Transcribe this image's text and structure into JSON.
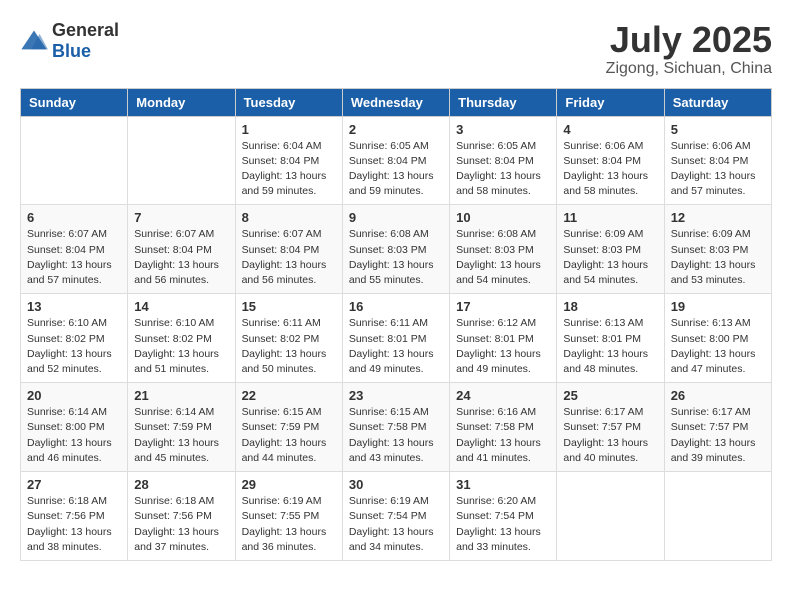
{
  "header": {
    "logo_general": "General",
    "logo_blue": "Blue",
    "title": "July 2025",
    "subtitle": "Zigong, Sichuan, China"
  },
  "calendar": {
    "days_of_week": [
      "Sunday",
      "Monday",
      "Tuesday",
      "Wednesday",
      "Thursday",
      "Friday",
      "Saturday"
    ],
    "weeks": [
      [
        {
          "day": "",
          "info": ""
        },
        {
          "day": "",
          "info": ""
        },
        {
          "day": "1",
          "info": "Sunrise: 6:04 AM\nSunset: 8:04 PM\nDaylight: 13 hours and 59 minutes."
        },
        {
          "day": "2",
          "info": "Sunrise: 6:05 AM\nSunset: 8:04 PM\nDaylight: 13 hours and 59 minutes."
        },
        {
          "day": "3",
          "info": "Sunrise: 6:05 AM\nSunset: 8:04 PM\nDaylight: 13 hours and 58 minutes."
        },
        {
          "day": "4",
          "info": "Sunrise: 6:06 AM\nSunset: 8:04 PM\nDaylight: 13 hours and 58 minutes."
        },
        {
          "day": "5",
          "info": "Sunrise: 6:06 AM\nSunset: 8:04 PM\nDaylight: 13 hours and 57 minutes."
        }
      ],
      [
        {
          "day": "6",
          "info": "Sunrise: 6:07 AM\nSunset: 8:04 PM\nDaylight: 13 hours and 57 minutes."
        },
        {
          "day": "7",
          "info": "Sunrise: 6:07 AM\nSunset: 8:04 PM\nDaylight: 13 hours and 56 minutes."
        },
        {
          "day": "8",
          "info": "Sunrise: 6:07 AM\nSunset: 8:04 PM\nDaylight: 13 hours and 56 minutes."
        },
        {
          "day": "9",
          "info": "Sunrise: 6:08 AM\nSunset: 8:03 PM\nDaylight: 13 hours and 55 minutes."
        },
        {
          "day": "10",
          "info": "Sunrise: 6:08 AM\nSunset: 8:03 PM\nDaylight: 13 hours and 54 minutes."
        },
        {
          "day": "11",
          "info": "Sunrise: 6:09 AM\nSunset: 8:03 PM\nDaylight: 13 hours and 54 minutes."
        },
        {
          "day": "12",
          "info": "Sunrise: 6:09 AM\nSunset: 8:03 PM\nDaylight: 13 hours and 53 minutes."
        }
      ],
      [
        {
          "day": "13",
          "info": "Sunrise: 6:10 AM\nSunset: 8:02 PM\nDaylight: 13 hours and 52 minutes."
        },
        {
          "day": "14",
          "info": "Sunrise: 6:10 AM\nSunset: 8:02 PM\nDaylight: 13 hours and 51 minutes."
        },
        {
          "day": "15",
          "info": "Sunrise: 6:11 AM\nSunset: 8:02 PM\nDaylight: 13 hours and 50 minutes."
        },
        {
          "day": "16",
          "info": "Sunrise: 6:11 AM\nSunset: 8:01 PM\nDaylight: 13 hours and 49 minutes."
        },
        {
          "day": "17",
          "info": "Sunrise: 6:12 AM\nSunset: 8:01 PM\nDaylight: 13 hours and 49 minutes."
        },
        {
          "day": "18",
          "info": "Sunrise: 6:13 AM\nSunset: 8:01 PM\nDaylight: 13 hours and 48 minutes."
        },
        {
          "day": "19",
          "info": "Sunrise: 6:13 AM\nSunset: 8:00 PM\nDaylight: 13 hours and 47 minutes."
        }
      ],
      [
        {
          "day": "20",
          "info": "Sunrise: 6:14 AM\nSunset: 8:00 PM\nDaylight: 13 hours and 46 minutes."
        },
        {
          "day": "21",
          "info": "Sunrise: 6:14 AM\nSunset: 7:59 PM\nDaylight: 13 hours and 45 minutes."
        },
        {
          "day": "22",
          "info": "Sunrise: 6:15 AM\nSunset: 7:59 PM\nDaylight: 13 hours and 44 minutes."
        },
        {
          "day": "23",
          "info": "Sunrise: 6:15 AM\nSunset: 7:58 PM\nDaylight: 13 hours and 43 minutes."
        },
        {
          "day": "24",
          "info": "Sunrise: 6:16 AM\nSunset: 7:58 PM\nDaylight: 13 hours and 41 minutes."
        },
        {
          "day": "25",
          "info": "Sunrise: 6:17 AM\nSunset: 7:57 PM\nDaylight: 13 hours and 40 minutes."
        },
        {
          "day": "26",
          "info": "Sunrise: 6:17 AM\nSunset: 7:57 PM\nDaylight: 13 hours and 39 minutes."
        }
      ],
      [
        {
          "day": "27",
          "info": "Sunrise: 6:18 AM\nSunset: 7:56 PM\nDaylight: 13 hours and 38 minutes."
        },
        {
          "day": "28",
          "info": "Sunrise: 6:18 AM\nSunset: 7:56 PM\nDaylight: 13 hours and 37 minutes."
        },
        {
          "day": "29",
          "info": "Sunrise: 6:19 AM\nSunset: 7:55 PM\nDaylight: 13 hours and 36 minutes."
        },
        {
          "day": "30",
          "info": "Sunrise: 6:19 AM\nSunset: 7:54 PM\nDaylight: 13 hours and 34 minutes."
        },
        {
          "day": "31",
          "info": "Sunrise: 6:20 AM\nSunset: 7:54 PM\nDaylight: 13 hours and 33 minutes."
        },
        {
          "day": "",
          "info": ""
        },
        {
          "day": "",
          "info": ""
        }
      ]
    ]
  }
}
